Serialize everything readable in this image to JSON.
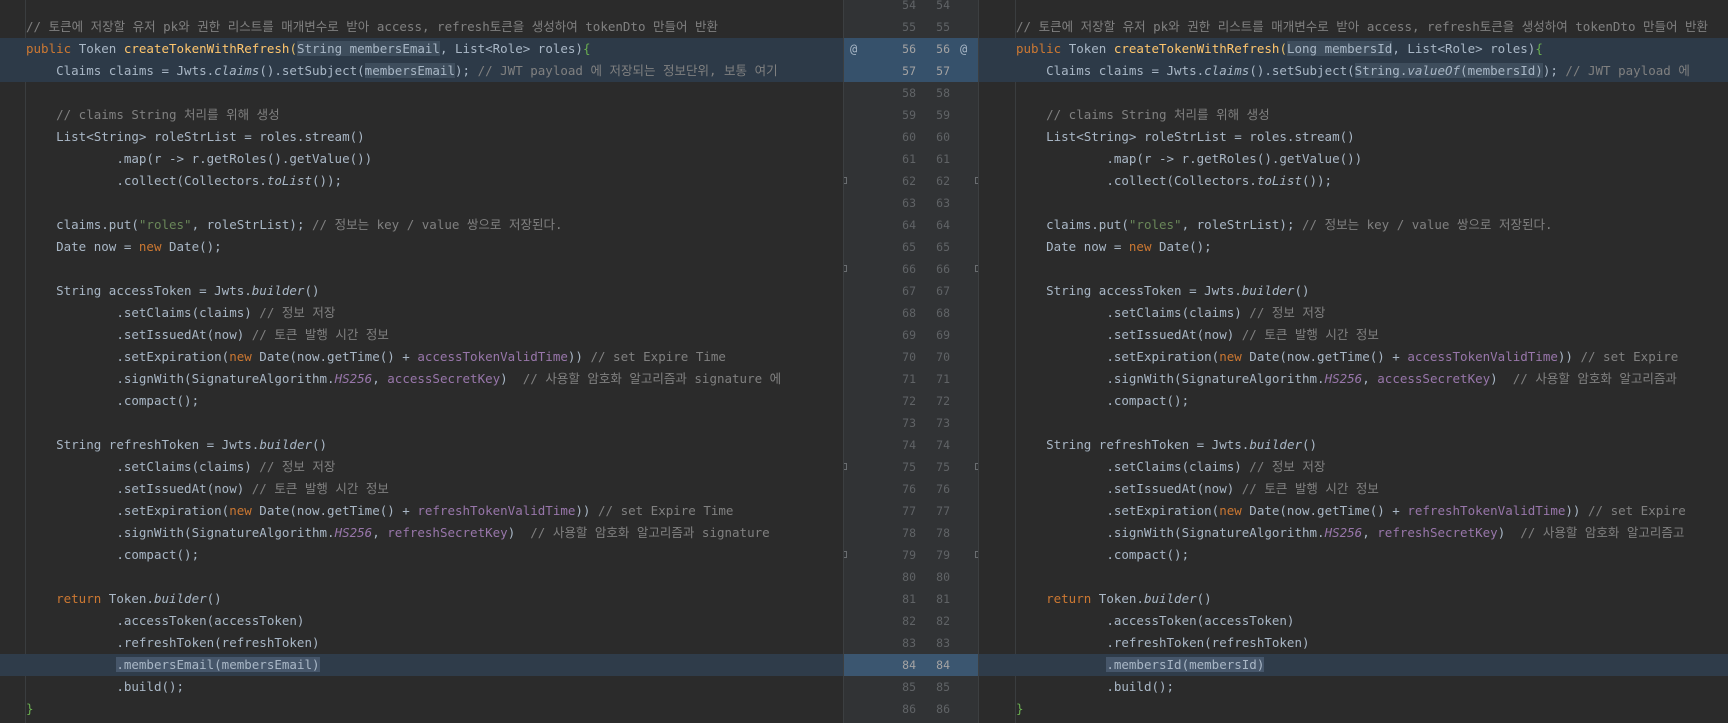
{
  "gutter": {
    "left_numbers": [
      "54",
      "55",
      "56",
      "57",
      "58",
      "59",
      "60",
      "61",
      "62",
      "63",
      "64",
      "65",
      "66",
      "67",
      "68",
      "69",
      "70",
      "71",
      "72",
      "73",
      "74",
      "75",
      "76",
      "77",
      "78",
      "79",
      "80",
      "81",
      "82",
      "83",
      "84",
      "85",
      "86"
    ],
    "right_numbers": [
      "54",
      "55",
      "56",
      "57",
      "58",
      "59",
      "60",
      "61",
      "62",
      "63",
      "64",
      "65",
      "66",
      "67",
      "68",
      "69",
      "70",
      "71",
      "72",
      "73",
      "74",
      "75",
      "76",
      "77",
      "78",
      "79",
      "80",
      "81",
      "82",
      "83",
      "84",
      "85",
      "86"
    ],
    "annotation_glyph": "@"
  },
  "left": {
    "comment_header": "// 토큰에 저장할 유저 pk와 권한 리스트를 매개변수로 받아 access, refresh토큰을 생성하여 tokenDto 만들어 반환",
    "sig_kw": "public",
    "sig_type": "Token",
    "sig_name": "createTokenWithRefresh",
    "sig_paren_open": "(",
    "sig_param1": "String membersEmail",
    "sig_rest": ", List<Role> roles)",
    "sig_brace": "{",
    "claims_pre": "Claims claims = Jwts.",
    "claims_call": "claims",
    "claims_mid": "().setSubject(",
    "claims_arg": "membersEmail",
    "claims_end": ");",
    "claims_comment": " // JWT payload 에 저장되는 정보단위, 보통 여기",
    "comment_claims": "// claims String 처리를 위해 생성",
    "rolelist": "List<String> roleStrList = roles.stream()",
    "map": ".map(r -> r.getRoles().getValue())",
    "collect_pre": ".collect(Collectors.",
    "collect_call": "toList",
    "collect_end": "());",
    "put_pre": "claims.put(",
    "put_str": "\"roles\"",
    "put_mid": ", roleStrList);",
    "put_comment": " // 정보는 key / value 쌍으로 저장된다.",
    "date_pre": "Date now = ",
    "date_kw": "new",
    "date_end": " Date();",
    "access_decl_pre": "String accessToken = Jwts.",
    "builder_call": "builder",
    "builder_end": "()",
    "set_claims": ".setClaims(claims)",
    "set_claims_comment": " // 정보 저장",
    "set_issued": ".setIssuedAt(now)",
    "set_issued_comment": " // 토큰 발행 시간 정보",
    "set_exp_pre": ".setExpiration(",
    "set_exp_kw": "new",
    "set_exp_mid": " Date(now.getTime() + ",
    "access_valid": "accessTokenValidTime",
    "set_exp_end": "))",
    "set_exp_comment": " // set Expire Time",
    "sign_pre": ".signWith(SignatureAlgorithm.",
    "sign_alg": "HS256",
    "sign_sep": ", ",
    "access_key": "accessSecretKey",
    "sign_end": ")",
    "sign_comment": "  // 사용할 암호화 알고리즘과 signature 에",
    "compact": ".compact();",
    "refresh_decl_pre": "String refreshToken = Jwts.",
    "refresh_valid": "refreshTokenValidTime",
    "refresh_key": "refreshSecretKey",
    "sign_comment2": "  // 사용할 암호화 알고리즘과 signature ",
    "return_kw": "return",
    "return_rest": " Token.",
    "access_token_call": ".accessToken(accessToken)",
    "refresh_token_call": ".refreshToken(refreshToken)",
    "members_call": ".membersEmail",
    "members_paren": "(membersEmail)",
    "build": ".build();",
    "close_brace": "}"
  },
  "right": {
    "comment_header": "// 토큰에 저장할 유저 pk와 권한 리스트를 매개변수로 받아 access, refresh토큰을 생성하여 tokenDto 만들어 반환",
    "sig_param1": "Long membersId",
    "claims_arg_pre": "String.",
    "claims_arg_call": "valueOf",
    "claims_arg_post": "(membersId)",
    "claims_end": ");",
    "claims_comment": " // JWT payload 에",
    "set_exp_comment": " // set Expire ",
    "sign_comment": "  // 사용할 암호화 알고리즘과",
    "set_exp_comment2": " // set Expire",
    "sign_comment2": "  // 사용할 암호화 알고리즘고",
    "members_call": ".membersId",
    "members_paren": "(membersId)"
  }
}
